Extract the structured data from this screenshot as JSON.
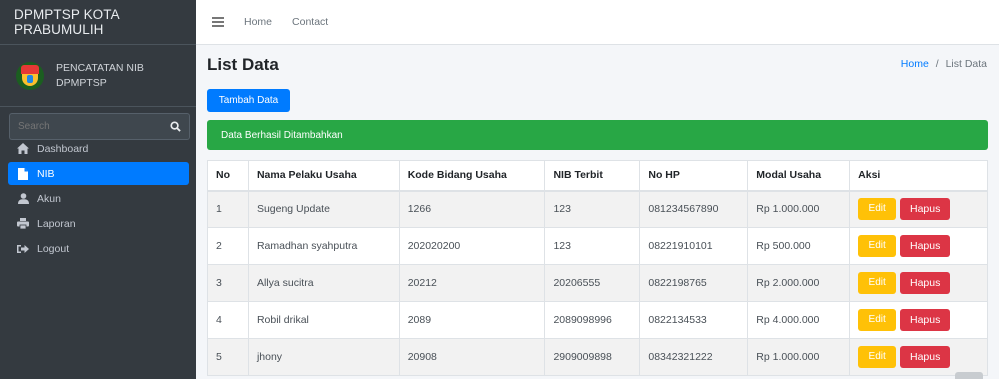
{
  "sidebar": {
    "brand": "DPMPTSP KOTA PRABUMULIH",
    "user_line1": "PENCATATAN NIB",
    "user_line2": "DPMPTSP",
    "search_placeholder": "Search",
    "items": [
      {
        "label": "Dashboard",
        "icon": "home-icon",
        "active": false
      },
      {
        "label": "NIB",
        "icon": "file-icon",
        "active": true
      },
      {
        "label": "Akun",
        "icon": "user-icon",
        "active": false
      },
      {
        "label": "Laporan",
        "icon": "print-icon",
        "active": false
      },
      {
        "label": "Logout",
        "icon": "logout-icon",
        "active": false
      }
    ]
  },
  "topbar": {
    "home": "Home",
    "contact": "Contact"
  },
  "page": {
    "title": "List Data",
    "breadcrumb_home": "Home",
    "breadcrumb_sep": "/",
    "breadcrumb_current": "List Data",
    "add_button": "Tambah Data",
    "alert": "Data Berhasil Ditambahkan"
  },
  "table": {
    "headers": [
      "No",
      "Nama Pelaku Usaha",
      "Kode Bidang Usaha",
      "NIB Terbit",
      "No HP",
      "Modal Usaha",
      "Aksi"
    ],
    "rows": [
      {
        "no": "1",
        "nama": "Sugeng Update",
        "kode": "1266",
        "nib": "123",
        "hp": "081234567890",
        "modal": "Rp 1.000.000"
      },
      {
        "no": "2",
        "nama": "Ramadhan syahputra",
        "kode": "202020200",
        "nib": "123",
        "hp": "08221910101",
        "modal": "Rp 500.000"
      },
      {
        "no": "3",
        "nama": "Allya sucitra",
        "kode": "20212",
        "nib": "20206555",
        "hp": "0822198765",
        "modal": "Rp 2.000.000"
      },
      {
        "no": "4",
        "nama": "Robil drikal",
        "kode": "2089",
        "nib": "2089098996",
        "hp": "0822134533",
        "modal": "Rp 4.000.000"
      },
      {
        "no": "5",
        "nama": "jhony",
        "kode": "20908",
        "nib": "2909009898",
        "hp": "08342321222",
        "modal": "Rp 1.000.000"
      }
    ],
    "edit_label": "Edit",
    "delete_label": "Hapus"
  },
  "colors": {
    "sidebar_bg": "#343a40",
    "primary": "#007bff",
    "success": "#28a745",
    "warning": "#ffc107",
    "danger": "#dc3545"
  }
}
